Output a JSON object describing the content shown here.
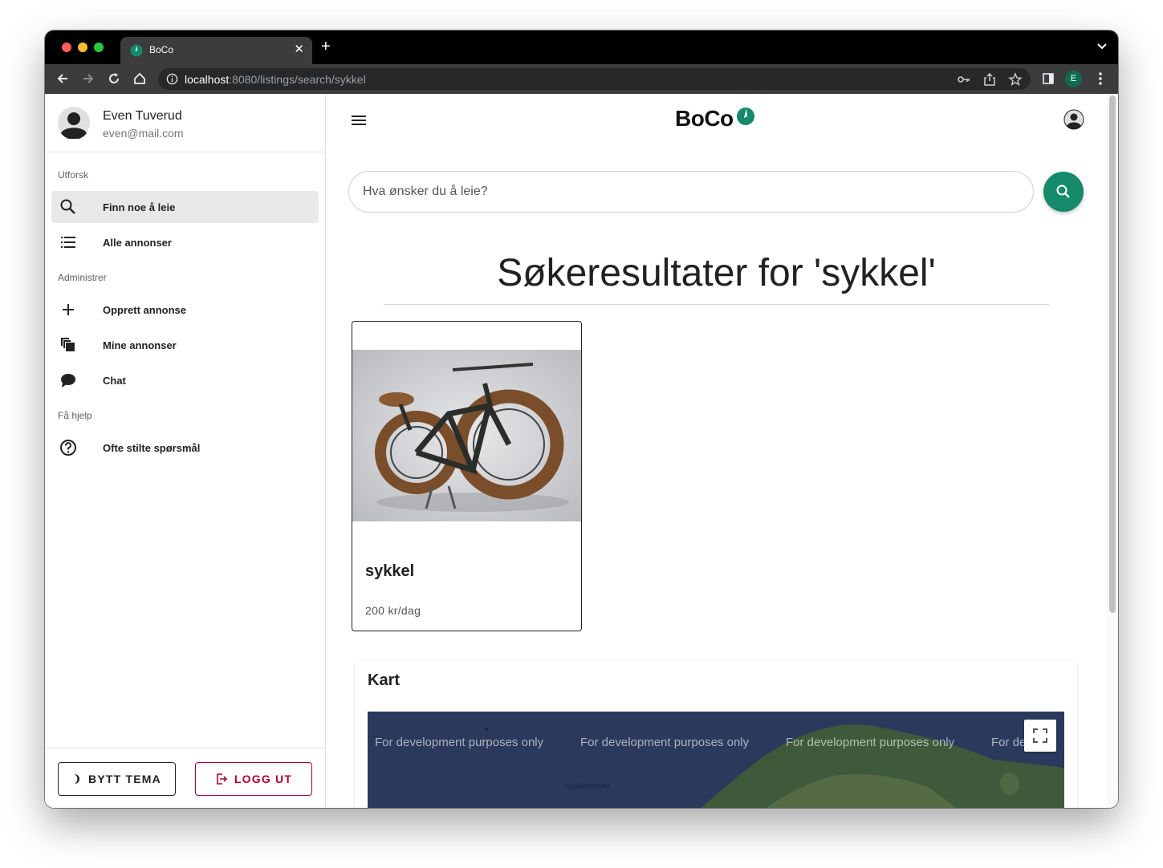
{
  "browser": {
    "tab_title": "BoCo",
    "new_tab_symbol": "+",
    "url_host": "localhost",
    "url_path": ":8080/listings/search/sykkel",
    "profile_initial": "E"
  },
  "user": {
    "name": "Even Tuverud",
    "email": "even@mail.com"
  },
  "sidebar": {
    "sections": [
      {
        "title": "Utforsk"
      },
      {
        "title": "Administrer"
      },
      {
        "title": "Få hjelp"
      }
    ],
    "items": [
      {
        "label": "Finn noe å leie",
        "icon": "search-icon",
        "active": true
      },
      {
        "label": "Alle annonser",
        "icon": "list-icon",
        "active": false
      },
      {
        "label": "Opprett annonse",
        "icon": "plus-icon",
        "active": false
      },
      {
        "label": "Mine annonser",
        "icon": "copy-icon",
        "active": false
      },
      {
        "label": "Chat",
        "icon": "chat-icon",
        "active": false
      },
      {
        "label": "Ofte stilte spørsmål",
        "icon": "help-circle-icon",
        "active": false
      }
    ],
    "theme_button": "BYTT TEMA",
    "logout_button": "LOGG UT"
  },
  "header": {
    "logo_text": "BoCo"
  },
  "search": {
    "placeholder": "Hva ønsker du å leie?"
  },
  "results": {
    "title": "Søkeresultater for 'sykkel'",
    "listings": [
      {
        "title": "sykkel",
        "price": "200 kr/dag"
      }
    ]
  },
  "map": {
    "title": "Kart",
    "watermark": "For development purposes only",
    "watermark_partial": "For de",
    "sea_label": "Norskehavet"
  },
  "colors": {
    "brand": "#148a6b",
    "logout": "#b0002a"
  }
}
